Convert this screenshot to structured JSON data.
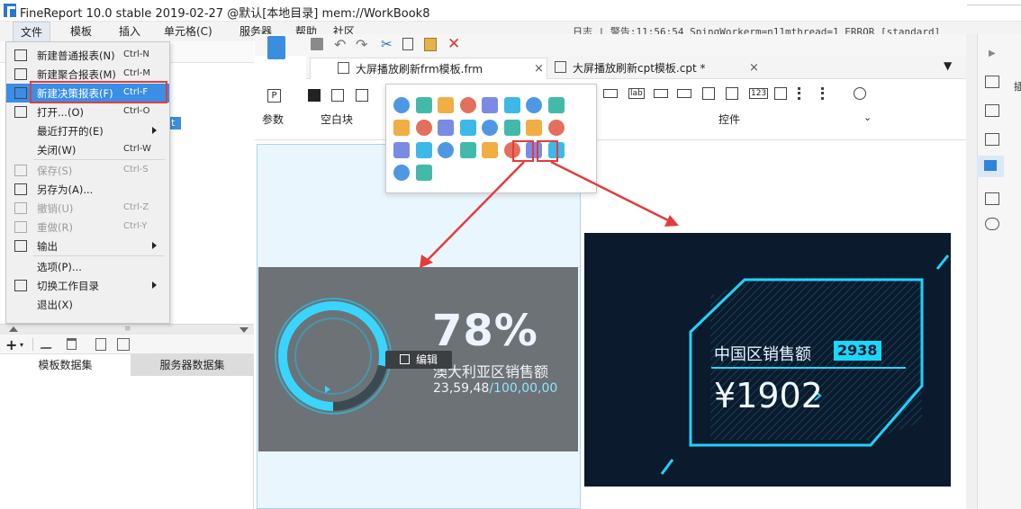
{
  "window": {
    "title": "FineReport 10.0 stable 2019-02-27 @默认[本地目录]     mem://WorkBook8"
  },
  "menubar": {
    "items": [
      "文件",
      "模板",
      "插入",
      "单元格(C)",
      "服务器",
      "帮助",
      "社区"
    ],
    "log": "日志 | 警告:11:56:54 SpingWorkerm=n11mthread=1 ERROR [standard]"
  },
  "file_menu": {
    "items": [
      {
        "label": "新建普通报表(N)",
        "shortcut": "Ctrl-N",
        "icon": "new-report-icon",
        "disabled": false
      },
      {
        "label": "新建聚合报表(M)",
        "shortcut": "Ctrl-M",
        "icon": "aggregate-report-icon",
        "disabled": false
      },
      {
        "label": "新建决策报表(F)",
        "shortcut": "Ctrl-F",
        "icon": "decision-report-icon",
        "disabled": false,
        "highlighted": true
      },
      {
        "label": "打开...(O)",
        "shortcut": "Ctrl-O",
        "icon": "open-folder-icon",
        "disabled": false
      },
      {
        "label": "最近打开的(E)",
        "shortcut": "",
        "icon": "",
        "disabled": false,
        "submenu": true
      },
      {
        "label": "关闭(W)",
        "shortcut": "Ctrl-W",
        "icon": "",
        "disabled": false
      },
      {
        "label": "保存(S)",
        "shortcut": "Ctrl-S",
        "icon": "save-icon",
        "disabled": true
      },
      {
        "label": "另存为(A)...",
        "shortcut": "",
        "icon": "save-as-icon",
        "disabled": false
      },
      {
        "label": "撤销(U)",
        "shortcut": "Ctrl-Z",
        "icon": "undo-icon",
        "disabled": true
      },
      {
        "label": "重做(R)",
        "shortcut": "Ctrl-Y",
        "icon": "redo-icon",
        "disabled": true
      },
      {
        "label": "输出",
        "shortcut": "",
        "icon": "export-icon",
        "disabled": false,
        "submenu": true
      },
      {
        "label": "选项(P)...",
        "shortcut": "",
        "icon": "",
        "disabled": false
      },
      {
        "label": "切换工作目录",
        "shortcut": "",
        "icon": "switch-dir-icon",
        "disabled": false,
        "submenu": true
      },
      {
        "label": "退出(X)",
        "shortcut": "",
        "icon": "",
        "disabled": false
      }
    ]
  },
  "left_panel": {
    "tree_badge": "t",
    "tabs": [
      "模板数据集",
      "服务器数据集"
    ]
  },
  "doc_tabs": [
    {
      "label": "大屏播放刷新frm模板.frm",
      "close": "×"
    },
    {
      "label": "大屏播放刷新cpt模板.cpt *",
      "close": "×"
    }
  ],
  "ribbon": {
    "groups": [
      "参数",
      "空白块",
      "控件"
    ]
  },
  "widget1": {
    "percent": "78%",
    "title": "澳大利亚区销售额",
    "value": "23,59,48",
    "target": "/100,00,00",
    "edit_label": "编辑",
    "progress": 0.78
  },
  "widget2": {
    "title": "中国区销售额",
    "badge": "2938",
    "amount": "¥1902"
  },
  "right_panel": {
    "label": "插"
  },
  "colors": {
    "accent": "#3a8ee6",
    "highlight_red": "#e53b3b",
    "neon_cyan": "#18d8ff"
  }
}
